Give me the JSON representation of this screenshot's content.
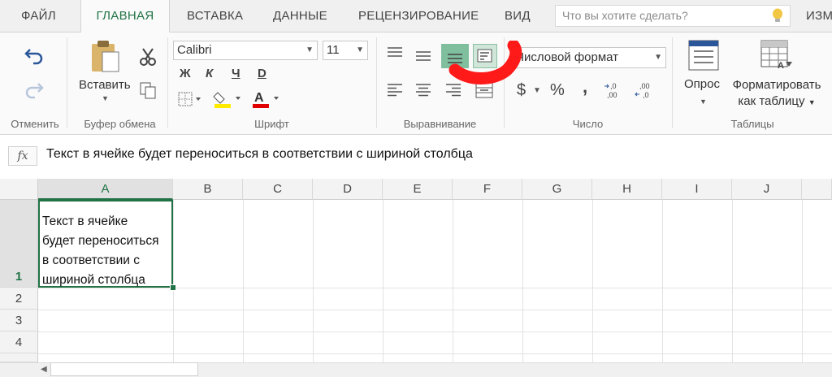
{
  "tabs": [
    {
      "label": "ФАЙЛ"
    },
    {
      "label": "ГЛАВНАЯ"
    },
    {
      "label": "ВСТАВКА"
    },
    {
      "label": "ДАННЫЕ"
    },
    {
      "label": "РЕЦЕНЗИРОВАНИЕ"
    },
    {
      "label": "ВИД"
    },
    {
      "label": "ИЗМ"
    }
  ],
  "search": {
    "placeholder": "Что вы хотите сделать?"
  },
  "ribbon": {
    "undo_group_label": "Отменить",
    "clipboard": {
      "paste_label": "Вставить",
      "group_label": "Буфер обмена"
    },
    "font": {
      "name": "Calibri",
      "size": "11",
      "bold": "Ж",
      "italic": "К",
      "underline": "Ч",
      "strike": "D",
      "group_label": "Шрифт"
    },
    "alignment": {
      "group_label": "Выравнивание"
    },
    "number": {
      "format": "Числовой формат",
      "currency": "$",
      "percent": "%",
      "comma": ",",
      "group_label": "Число"
    },
    "tables": {
      "survey_label": "Опрос",
      "format_table_line1": "Форматировать",
      "format_table_line2": "как таблицу",
      "group_label": "Таблицы"
    }
  },
  "formula_bar": {
    "fx": "fx",
    "content": "Текст в ячейке будет переноситься в соответствии с шириной столбца"
  },
  "grid": {
    "columns": [
      "A",
      "B",
      "C",
      "D",
      "E",
      "F",
      "G",
      "H",
      "I",
      "J"
    ],
    "rows": [
      "1",
      "2",
      "3",
      "4"
    ],
    "cell_a1": "Текст в ячейке\nбудет переноситься\nв соответствии с\nшириной столбца"
  },
  "colors": {
    "accent": "#217346",
    "annotation": "#ff1a1a"
  }
}
